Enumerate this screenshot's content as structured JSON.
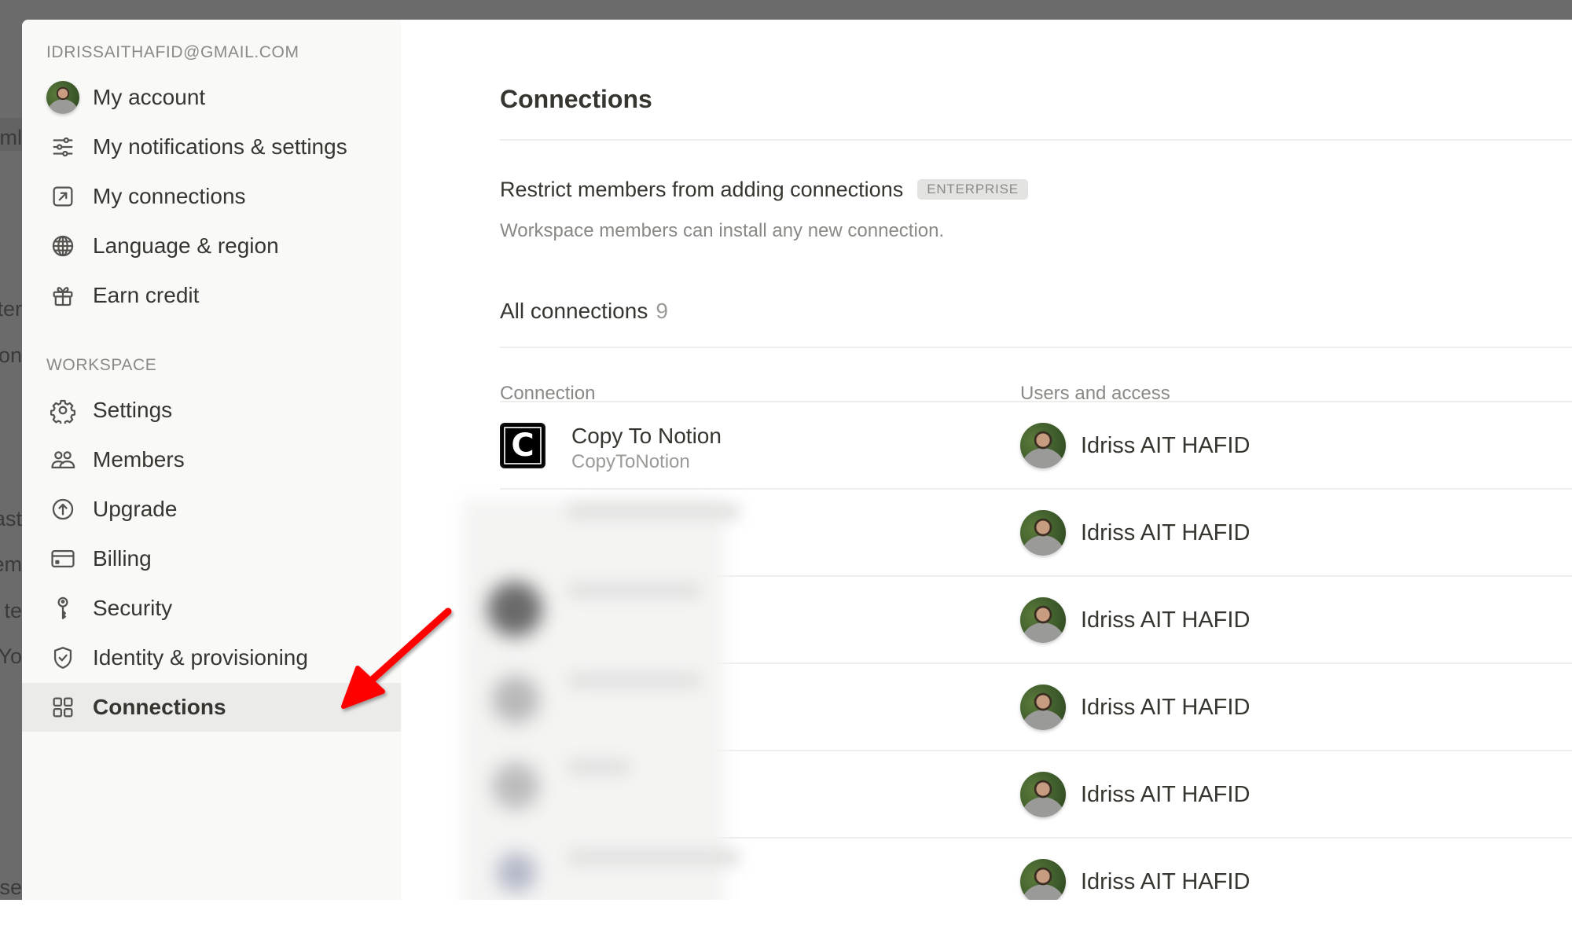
{
  "background_fragments": [
    "ml",
    "ter",
    "ion",
    "ast",
    "em",
    "te",
    "Yo",
    "ase"
  ],
  "sidebar": {
    "account_email": "IDRISSAITHAFID@GMAIL.COM",
    "account_items": [
      {
        "label": "My account",
        "icon": "avatar"
      },
      {
        "label": "My notifications & settings",
        "icon": "sliders-icon"
      },
      {
        "label": "My connections",
        "icon": "arrow-up-right-square-icon"
      },
      {
        "label": "Language & region",
        "icon": "globe-icon"
      },
      {
        "label": "Earn credit",
        "icon": "gift-icon"
      }
    ],
    "workspace_label": "WORKSPACE",
    "workspace_items": [
      {
        "label": "Settings",
        "icon": "gear-icon"
      },
      {
        "label": "Members",
        "icon": "people-icon"
      },
      {
        "label": "Upgrade",
        "icon": "arrow-up-circle-icon"
      },
      {
        "label": "Billing",
        "icon": "credit-card-icon"
      },
      {
        "label": "Security",
        "icon": "key-icon"
      },
      {
        "label": "Identity & provisioning",
        "icon": "shield-check-icon"
      },
      {
        "label": "Connections",
        "icon": "grid-icon",
        "active": true
      }
    ]
  },
  "main": {
    "title": "Connections",
    "restrict": {
      "title": "Restrict members from adding connections",
      "badge": "ENTERPRISE",
      "description": "Workspace members can install any new connection."
    },
    "all_connections": {
      "label": "All connections",
      "count": "9"
    },
    "table": {
      "columns": [
        "Connection",
        "Users and access"
      ],
      "rows": [
        {
          "icon_letter": "C",
          "name": "Copy To Notion",
          "handle": "CopyToNotion",
          "user": "Idriss AIT HAFID",
          "blurred": false
        },
        {
          "icon_letter": "",
          "name": "",
          "handle": "",
          "user": "Idriss AIT HAFID",
          "blurred": true
        },
        {
          "icon_letter": "",
          "name": "",
          "handle": "",
          "user": "Idriss AIT HAFID",
          "blurred": true
        },
        {
          "icon_letter": "",
          "name": "",
          "handle": "",
          "user": "Idriss AIT HAFID",
          "blurred": true
        },
        {
          "icon_letter": "",
          "name": "",
          "handle": "",
          "user": "Idriss AIT HAFID",
          "blurred": true
        },
        {
          "icon_letter": "",
          "name": "",
          "handle": "",
          "user": "Idriss AIT HAFID",
          "blurred": true
        }
      ]
    }
  },
  "annotation": {
    "type": "red-arrow",
    "points_to": "Connections",
    "color": "#ff0000"
  },
  "colors": {
    "backdrop": "#6b6b6b",
    "sidebar_bg": "#f9f9f8",
    "active_item_bg": "#ebebea",
    "text_primary": "#37352f",
    "text_secondary": "#8a8985",
    "divider": "#ededec",
    "badge_bg": "#e3e3e1"
  }
}
